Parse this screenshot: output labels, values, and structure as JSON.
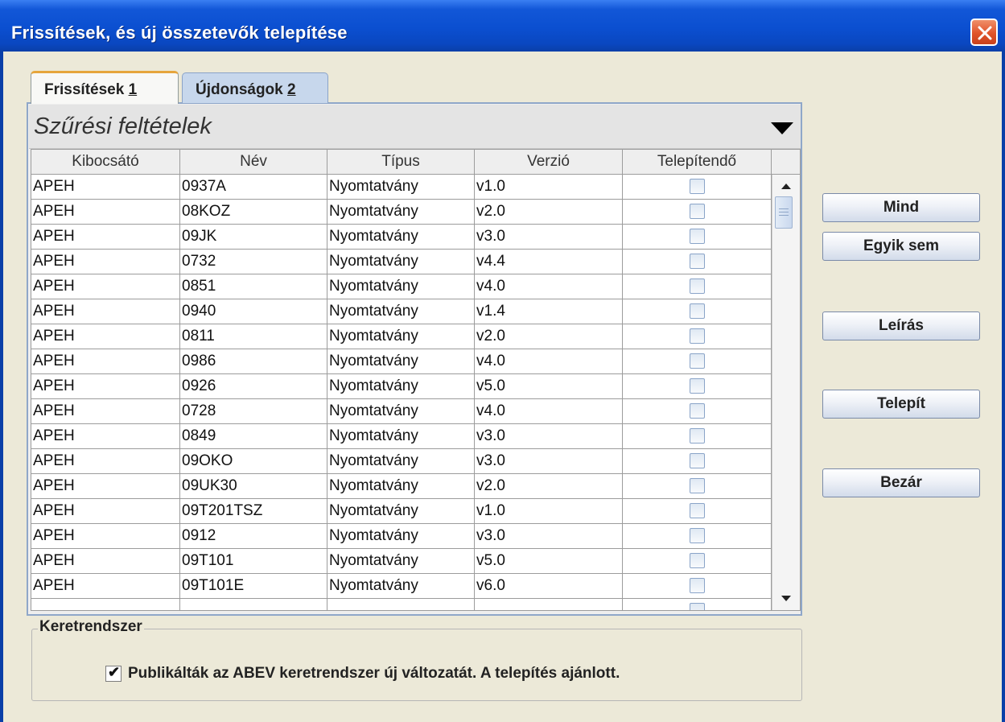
{
  "window": {
    "title": "Frissítések, és új összetevők telepítése"
  },
  "tabs": [
    {
      "label": "Frissítések ",
      "mnemonic": "1",
      "active": true
    },
    {
      "label": "Újdonságok ",
      "mnemonic": "2",
      "active": false
    }
  ],
  "filter": {
    "label": "Szűrési feltételek"
  },
  "table": {
    "columns": [
      "Kibocsátó",
      "Név",
      "Típus",
      "Verzió",
      "Telepítendő"
    ],
    "rows": [
      {
        "issuer": "APEH",
        "name": "0937A",
        "type": "Nyomtatvány",
        "version": "v1.0",
        "install": false
      },
      {
        "issuer": "APEH",
        "name": "08KOZ",
        "type": "Nyomtatvány",
        "version": "v2.0",
        "install": false
      },
      {
        "issuer": "APEH",
        "name": "09JK",
        "type": "Nyomtatvány",
        "version": "v3.0",
        "install": false
      },
      {
        "issuer": "APEH",
        "name": "0732",
        "type": "Nyomtatvány",
        "version": "v4.4",
        "install": false
      },
      {
        "issuer": "APEH",
        "name": "0851",
        "type": "Nyomtatvány",
        "version": "v4.0",
        "install": false
      },
      {
        "issuer": "APEH",
        "name": "0940",
        "type": "Nyomtatvány",
        "version": "v1.4",
        "install": false
      },
      {
        "issuer": "APEH",
        "name": "0811",
        "type": "Nyomtatvány",
        "version": "v2.0",
        "install": false
      },
      {
        "issuer": "APEH",
        "name": "0986",
        "type": "Nyomtatvány",
        "version": "v4.0",
        "install": false
      },
      {
        "issuer": "APEH",
        "name": "0926",
        "type": "Nyomtatvány",
        "version": "v5.0",
        "install": false
      },
      {
        "issuer": "APEH",
        "name": "0728",
        "type": "Nyomtatvány",
        "version": "v4.0",
        "install": false
      },
      {
        "issuer": "APEH",
        "name": "0849",
        "type": "Nyomtatvány",
        "version": "v3.0",
        "install": false
      },
      {
        "issuer": "APEH",
        "name": "09OKO",
        "type": "Nyomtatvány",
        "version": "v3.0",
        "install": false
      },
      {
        "issuer": "APEH",
        "name": "09UK30",
        "type": "Nyomtatvány",
        "version": "v2.0",
        "install": false
      },
      {
        "issuer": "APEH",
        "name": "09T201TSZ",
        "type": "Nyomtatvány",
        "version": "v1.0",
        "install": false
      },
      {
        "issuer": "APEH",
        "name": "0912",
        "type": "Nyomtatvány",
        "version": "v3.0",
        "install": false
      },
      {
        "issuer": "APEH",
        "name": "09T101",
        "type": "Nyomtatvány",
        "version": "v5.0",
        "install": false
      },
      {
        "issuer": "APEH",
        "name": "09T101E",
        "type": "Nyomtatvány",
        "version": "v6.0",
        "install": false
      },
      {
        "issuer": "",
        "name": "",
        "type": "",
        "version": "",
        "install": false
      }
    ]
  },
  "buttons": {
    "all": "Mind",
    "none": "Egyik sem",
    "description": "Leírás",
    "install": "Telepít",
    "close": "Bezár"
  },
  "framework": {
    "title": "Keretrendszer",
    "checked": true,
    "label": "Publikálták az ABEV keretrendszer új változatát. A telepítés ajánlott."
  },
  "colors": {
    "titlebar": "#0b4fd0",
    "close": "#e0532a",
    "background": "#ece9d8",
    "active_tab_accent": "#e6a53c"
  },
  "icons": {
    "close": "close-icon",
    "dropdown": "dropdown-arrow-icon",
    "scroll_up": "scroll-up-icon",
    "scroll_down": "scroll-down-icon",
    "check": "checkmark-icon"
  }
}
